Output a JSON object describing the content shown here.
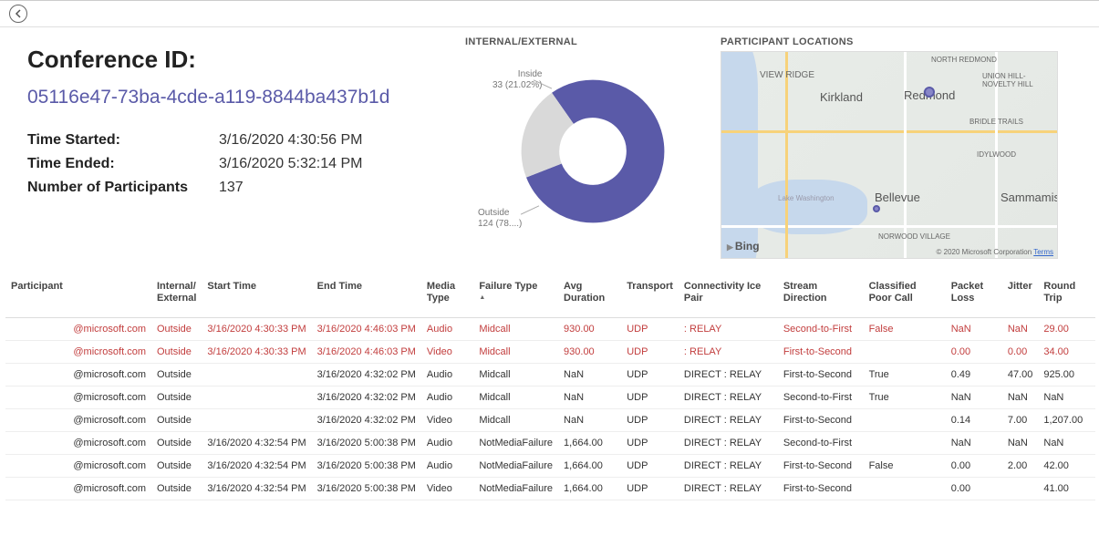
{
  "header": {
    "conf_label": "Conference ID:",
    "conf_id": "05116e47-73ba-4cde-a119-8844ba437b1d",
    "time_started_label": "Time Started:",
    "time_started": "3/16/2020 4:30:56 PM",
    "time_ended_label": "Time Ended:",
    "time_ended": "3/16/2020 5:32:14 PM",
    "participants_label": "Number of Participants",
    "participants": "137"
  },
  "donut": {
    "title": "INTERNAL/EXTERNAL",
    "inside_label": "Inside",
    "inside_value": "33 (21.02%)",
    "outside_label": "Outside",
    "outside_value": "124 (78....)"
  },
  "map": {
    "title": "PARTICIPANT LOCATIONS",
    "bing": "Bing",
    "copyright": "© 2020 Microsoft Corporation",
    "terms": "Terms",
    "labels": {
      "viewridge": "VIEW RIDGE",
      "kirkland": "Kirkland",
      "redmond": "Redmond",
      "northredmond": "NORTH REDMOND",
      "unionhill": "UNION HILL-NOVELTY HILL",
      "bridle": "BRIDLE TRAILS",
      "idylwood": "IDYLWOOD",
      "bellevue": "Bellevue",
      "sammamish": "Sammamish",
      "lakewa": "Lake Washington",
      "norwood": "NORWOOD VILLAGE"
    }
  },
  "columns": {
    "participant": "Participant",
    "intext": "Internal/\nExternal",
    "start": "Start Time",
    "end": "End Time",
    "media": "Media Type",
    "failure": "Failure Type",
    "avgdur": "Avg Duration",
    "transport": "Transport",
    "ice": "Connectivity Ice Pair",
    "streamdir": "Stream Direction",
    "classified": "Classified Poor Call",
    "packetloss": "Packet Loss",
    "jitter": "Jitter",
    "roundtrip": "Round Trip"
  },
  "rows": [
    {
      "poor": true,
      "participant": "@microsoft.com",
      "intext": "Outside",
      "start": "3/16/2020 4:30:33 PM",
      "end": "3/16/2020 4:46:03 PM",
      "media": "Audio",
      "failure": "Midcall",
      "avgdur": "930.00",
      "transport": "UDP",
      "ice": ": RELAY",
      "streamdir": "Second-to-First",
      "classified": "False",
      "packetloss": "NaN",
      "jitter": "NaN",
      "roundtrip": "29.00"
    },
    {
      "poor": true,
      "participant": "@microsoft.com",
      "intext": "Outside",
      "start": "3/16/2020 4:30:33 PM",
      "end": "3/16/2020 4:46:03 PM",
      "media": "Video",
      "failure": "Midcall",
      "avgdur": "930.00",
      "transport": "UDP",
      "ice": ": RELAY",
      "streamdir": "First-to-Second",
      "classified": "",
      "packetloss": "0.00",
      "jitter": "0.00",
      "roundtrip": "34.00"
    },
    {
      "poor": false,
      "participant": "@microsoft.com",
      "intext": "Outside",
      "start": "",
      "end": "3/16/2020 4:32:02 PM",
      "media": "Audio",
      "failure": "Midcall",
      "avgdur": "NaN",
      "transport": "UDP",
      "ice": "DIRECT : RELAY",
      "streamdir": "First-to-Second",
      "classified": "True",
      "packetloss": "0.49",
      "jitter": "47.00",
      "roundtrip": "925.00"
    },
    {
      "poor": false,
      "participant": "@microsoft.com",
      "intext": "Outside",
      "start": "",
      "end": "3/16/2020 4:32:02 PM",
      "media": "Audio",
      "failure": "Midcall",
      "avgdur": "NaN",
      "transport": "UDP",
      "ice": "DIRECT : RELAY",
      "streamdir": "Second-to-First",
      "classified": "True",
      "packetloss": "NaN",
      "jitter": "NaN",
      "roundtrip": "NaN"
    },
    {
      "poor": false,
      "participant": "@microsoft.com",
      "intext": "Outside",
      "start": "",
      "end": "3/16/2020 4:32:02 PM",
      "media": "Video",
      "failure": "Midcall",
      "avgdur": "NaN",
      "transport": "UDP",
      "ice": "DIRECT : RELAY",
      "streamdir": "First-to-Second",
      "classified": "",
      "packetloss": "0.14",
      "jitter": "7.00",
      "roundtrip": "1,207.00"
    },
    {
      "poor": false,
      "participant": "@microsoft.com",
      "intext": "Outside",
      "start": "3/16/2020 4:32:54 PM",
      "end": "3/16/2020 5:00:38 PM",
      "media": "Audio",
      "failure": "NotMediaFailure",
      "avgdur": "1,664.00",
      "transport": "UDP",
      "ice": "DIRECT : RELAY",
      "streamdir": "Second-to-First",
      "classified": "",
      "packetloss": "NaN",
      "jitter": "NaN",
      "roundtrip": "NaN"
    },
    {
      "poor": false,
      "participant": "@microsoft.com",
      "intext": "Outside",
      "start": "3/16/2020 4:32:54 PM",
      "end": "3/16/2020 5:00:38 PM",
      "media": "Audio",
      "failure": "NotMediaFailure",
      "avgdur": "1,664.00",
      "transport": "UDP",
      "ice": "DIRECT : RELAY",
      "streamdir": "First-to-Second",
      "classified": "False",
      "packetloss": "0.00",
      "jitter": "2.00",
      "roundtrip": "42.00"
    },
    {
      "poor": false,
      "participant": "@microsoft.com",
      "intext": "Outside",
      "start": "3/16/2020 4:32:54 PM",
      "end": "3/16/2020 5:00:38 PM",
      "media": "Video",
      "failure": "NotMediaFailure",
      "avgdur": "1,664.00",
      "transport": "UDP",
      "ice": "DIRECT : RELAY",
      "streamdir": "First-to-Second",
      "classified": "",
      "packetloss": "0.00",
      "jitter": "",
      "roundtrip": "41.00"
    }
  ],
  "chart_data": {
    "type": "pie",
    "title": "INTERNAL/EXTERNAL",
    "series": [
      {
        "name": "Inside",
        "value": 33,
        "percent": 21.02
      },
      {
        "name": "Outside",
        "value": 124,
        "percent": 78.98
      }
    ]
  }
}
